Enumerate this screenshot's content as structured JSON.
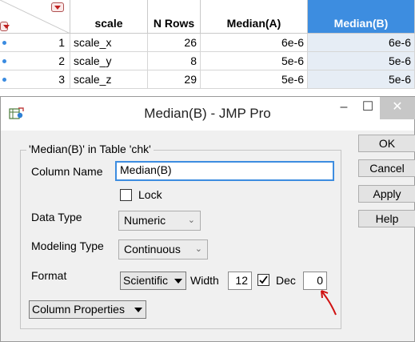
{
  "table": {
    "columns": [
      "scale",
      "N Rows",
      "Median(A)",
      "Median(B)"
    ],
    "rows": [
      {
        "num": "1",
        "scale": "scale_x",
        "nrows": "26",
        "medA": "6e-6",
        "medB": "6e-6"
      },
      {
        "num": "2",
        "scale": "scale_y",
        "nrows": "8",
        "medA": "5e-6",
        "medB": "5e-6"
      },
      {
        "num": "3",
        "scale": "scale_z",
        "nrows": "29",
        "medA": "5e-6",
        "medB": "5e-6"
      }
    ],
    "selected_column_color": "#3d8de0",
    "row_dot_color": "#3a8be0"
  },
  "dialog": {
    "title": "Median(B) - JMP Pro",
    "window_controls": {
      "minimize": "–",
      "maximize": "☐",
      "close": "✕"
    },
    "group_title": "'Median(B)' in Table 'chk'",
    "column_name_label": "Column Name",
    "column_name_value": "Median(B)",
    "lock_label": "Lock",
    "lock_checked": false,
    "data_type_label": "Data Type",
    "data_type_value": "Numeric",
    "modeling_type_label": "Modeling Type",
    "modeling_type_value": "Continuous",
    "format_label": "Format",
    "format_value": "Scientific",
    "width_label": "Width",
    "width_value": "12",
    "dec_checked": true,
    "dec_label": "Dec",
    "dec_value": "0",
    "column_properties_label": "Column Properties",
    "buttons": {
      "ok": "OK",
      "cancel": "Cancel",
      "apply": "Apply",
      "help": "Help"
    },
    "annotation_color": "#d01010"
  },
  "icons": {
    "red_dropdown": "red-triangle-menu-icon",
    "app": "jmp-app-icon",
    "chevron": "chevron-down-icon"
  }
}
